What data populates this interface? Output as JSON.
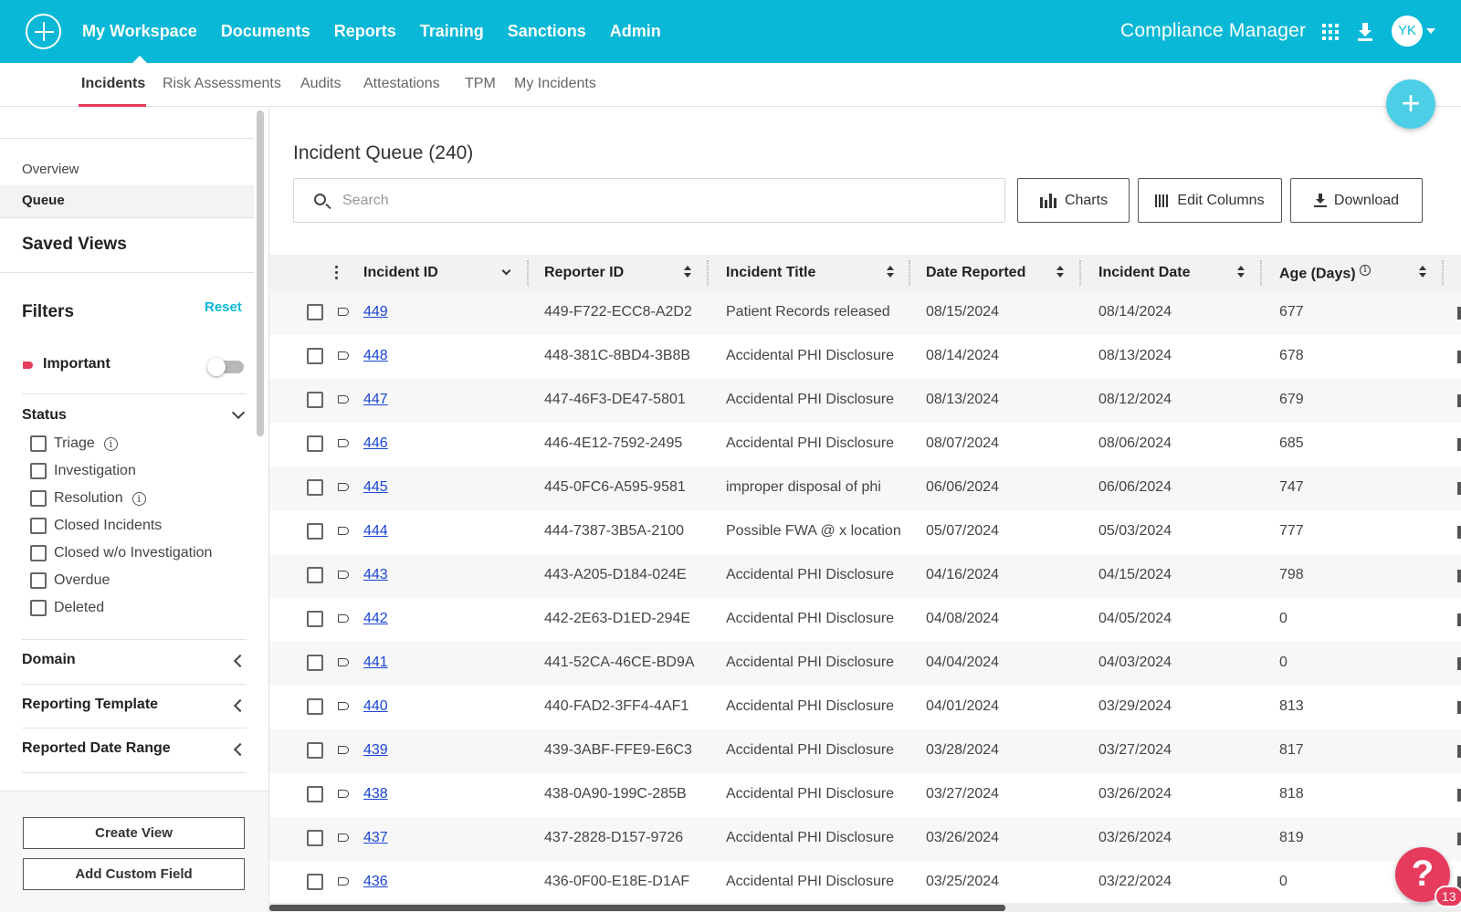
{
  "topbar": {
    "nav": [
      "My Workspace",
      "Documents",
      "Reports",
      "Training",
      "Sanctions",
      "Admin"
    ],
    "app_name": "Compliance Manager",
    "avatar": "YK",
    "brand_color": "#08b8d6"
  },
  "subtabs": [
    "Incidents",
    "Risk Assessments",
    "Audits",
    "Attestations",
    "TPM",
    "My Incidents"
  ],
  "fab": "+",
  "sidebar": {
    "links": [
      "Overview",
      "Queue"
    ],
    "saved_views": "Saved Views",
    "filters": "Filters",
    "reset": "Reset",
    "important": "Important",
    "status_title": "Status",
    "statuses": [
      "Triage",
      "Investigation",
      "Resolution",
      "Closed Incidents",
      "Closed w/o Investigation",
      "Overdue",
      "Deleted"
    ],
    "collapsibles": [
      "Domain",
      "Reporting Template",
      "Reported Date Range"
    ],
    "info_icon": "i",
    "create_view": "Create View",
    "add_custom_field": "Add Custom Field"
  },
  "main": {
    "title": "Incident Queue (240)",
    "search_placeholder": "Search",
    "charts": "Charts",
    "edit_columns": "Edit Columns",
    "download": "Download"
  },
  "table": {
    "columns": [
      "Incident ID",
      "Reporter ID",
      "Incident Title",
      "Date Reported",
      "Incident Date",
      "Age (Days)"
    ],
    "info_icon": "i",
    "rows": [
      [
        "449",
        "449-F722-ECC8-A2D2",
        "Patient Records released",
        "08/15/2024",
        "08/14/2024",
        "677"
      ],
      [
        "448",
        "448-381C-8BD4-3B8B",
        "Accidental PHI Disclosure",
        "08/14/2024",
        "08/13/2024",
        "678"
      ],
      [
        "447",
        "447-46F3-DE47-5801",
        "Accidental PHI Disclosure",
        "08/13/2024",
        "08/12/2024",
        "679"
      ],
      [
        "446",
        "446-4E12-7592-2495",
        "Accidental PHI Disclosure",
        "08/07/2024",
        "08/06/2024",
        "685"
      ],
      [
        "445",
        "445-0FC6-A595-9581",
        "improper disposal of phi",
        "06/06/2024",
        "06/06/2024",
        "747"
      ],
      [
        "444",
        "444-7387-3B5A-2100",
        "Possible FWA @ x location",
        "05/07/2024",
        "05/03/2024",
        "777"
      ],
      [
        "443",
        "443-A205-D184-024E",
        "Accidental PHI Disclosure",
        "04/16/2024",
        "04/15/2024",
        "798"
      ],
      [
        "442",
        "442-2E63-D1ED-294E",
        "Accidental PHI Disclosure",
        "04/08/2024",
        "04/05/2024",
        "0"
      ],
      [
        "441",
        "441-52CA-46CE-BD9A",
        "Accidental PHI Disclosure",
        "04/04/2024",
        "04/03/2024",
        "0"
      ],
      [
        "440",
        "440-FAD2-3FF4-4AF1",
        "Accidental PHI Disclosure",
        "04/01/2024",
        "03/29/2024",
        "813"
      ],
      [
        "439",
        "439-3ABF-FFE9-E6C3",
        "Accidental PHI Disclosure",
        "03/28/2024",
        "03/27/2024",
        "817"
      ],
      [
        "438",
        "438-0A90-199C-285B",
        "Accidental PHI Disclosure",
        "03/27/2024",
        "03/26/2024",
        "818"
      ],
      [
        "437",
        "437-2828-D157-9726",
        "Accidental PHI Disclosure",
        "03/26/2024",
        "03/26/2024",
        "819"
      ],
      [
        "436",
        "436-0F00-E18E-D1AF",
        "Accidental PHI Disclosure",
        "03/25/2024",
        "03/22/2024",
        "0"
      ]
    ]
  },
  "help": {
    "label": "?",
    "badge": "13"
  }
}
